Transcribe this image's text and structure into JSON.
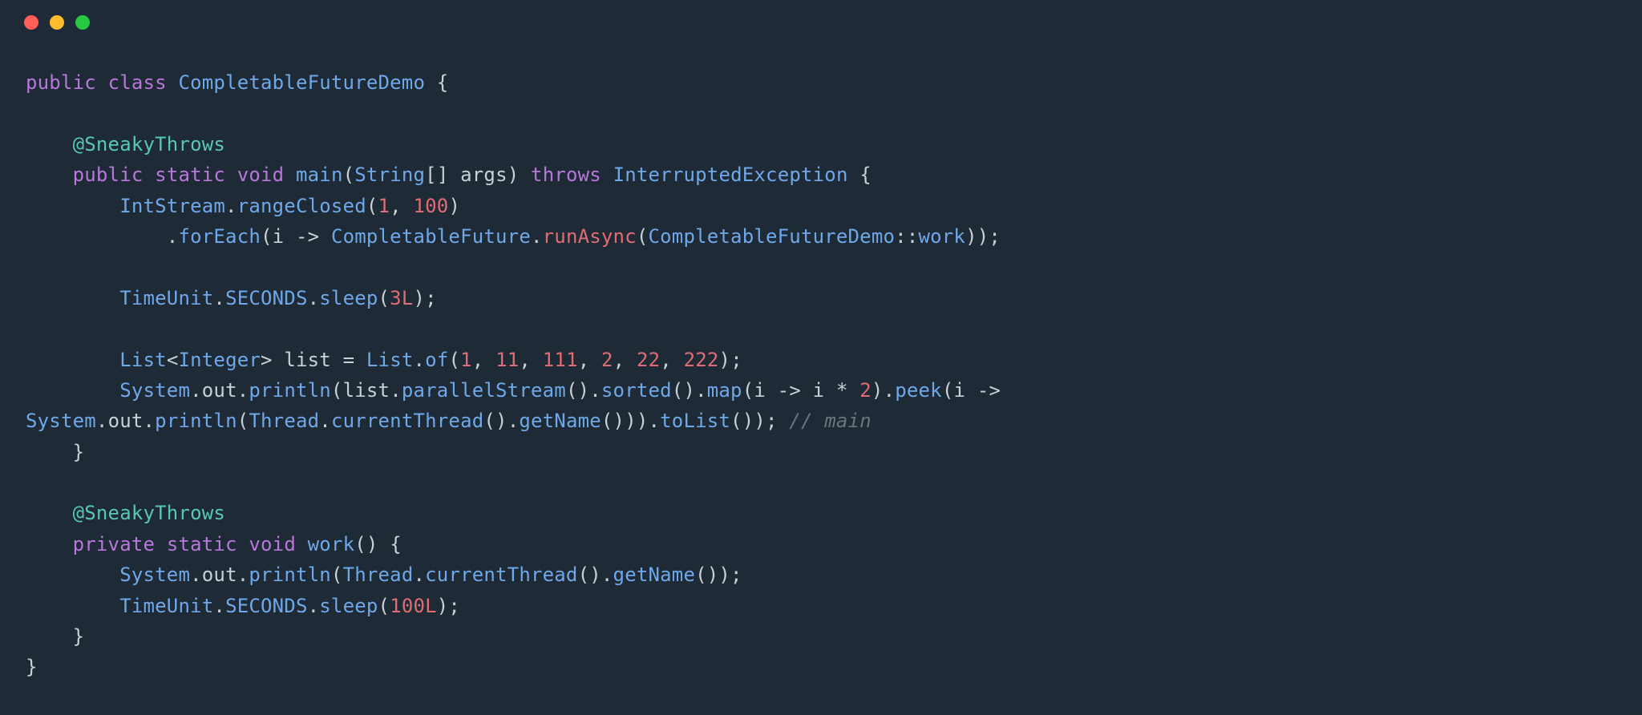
{
  "code": {
    "t": {
      "public": "public",
      "class": "class",
      "ClassName": "CompletableFutureDemo",
      "SneakyThrows": "@SneakyThrows",
      "static": "static",
      "void": "void",
      "main": "main",
      "String": "String",
      "args": "args",
      "throws": "throws",
      "InterruptedException": "InterruptedException",
      "IntStream": "IntStream",
      "rangeClosed": "rangeClosed",
      "n1": "1",
      "n100": "100",
      "forEach": "forEach",
      "i": "i",
      "arrow": "->",
      "CompletableFuture": "CompletableFuture",
      "runAsync": "runAsync",
      "work": "work",
      "TimeUnit": "TimeUnit",
      "SECONDS": "SECONDS",
      "sleep": "sleep",
      "n3L": "3L",
      "List": "List",
      "Integer": "Integer",
      "list": "list",
      "of": "of",
      "n11": "11",
      "n111": "111",
      "n2": "2",
      "n22": "22",
      "n222": "222",
      "System": "System",
      "out": "out",
      "println": "println",
      "parallelStream": "parallelStream",
      "sorted": "sorted",
      "map": "map",
      "star2": "2",
      "peek": "peek",
      "Thread": "Thread",
      "currentThread": "currentThread",
      "getName": "getName",
      "toList": "toList",
      "comment_main": "// main",
      "private": "private",
      "n100L": "100L"
    }
  }
}
